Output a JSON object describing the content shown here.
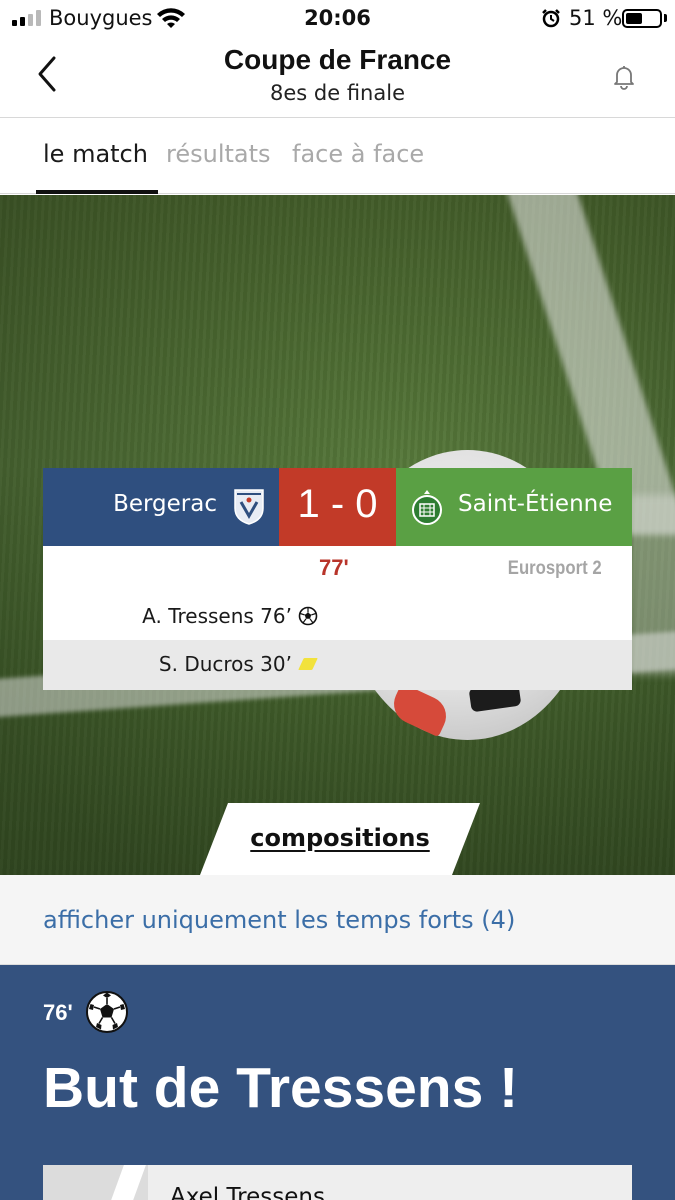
{
  "status_bar": {
    "carrier": "Bouygues",
    "time": "20:06",
    "battery_percent": "51 %",
    "battery_level": 0.51
  },
  "header": {
    "title": "Coupe de France",
    "subtitle": "8es de finale"
  },
  "tabs": [
    {
      "label": "le match",
      "active": true
    },
    {
      "label": "résultats",
      "active": false
    },
    {
      "label": "face à face",
      "active": false
    }
  ],
  "match": {
    "home_team": "Bergerac",
    "away_team": "Saint-Étienne",
    "score": "1 - 0",
    "minute": "77'",
    "channel": "Eurosport 2",
    "colors": {
      "home": "#2f4f7f",
      "score": "#c23a28",
      "away": "#5aa044"
    },
    "events": [
      {
        "text": "A. Tressens  76’",
        "type": "goal"
      },
      {
        "text": "S. Ducros  30’",
        "type": "yellow-card"
      }
    ]
  },
  "compositions_label": "compositions",
  "highlights_link": "afficher uniquement les temps forts (4)",
  "goal_event": {
    "minute": "76'",
    "title": "But de Tressens !",
    "player": "Axel Tressens"
  }
}
